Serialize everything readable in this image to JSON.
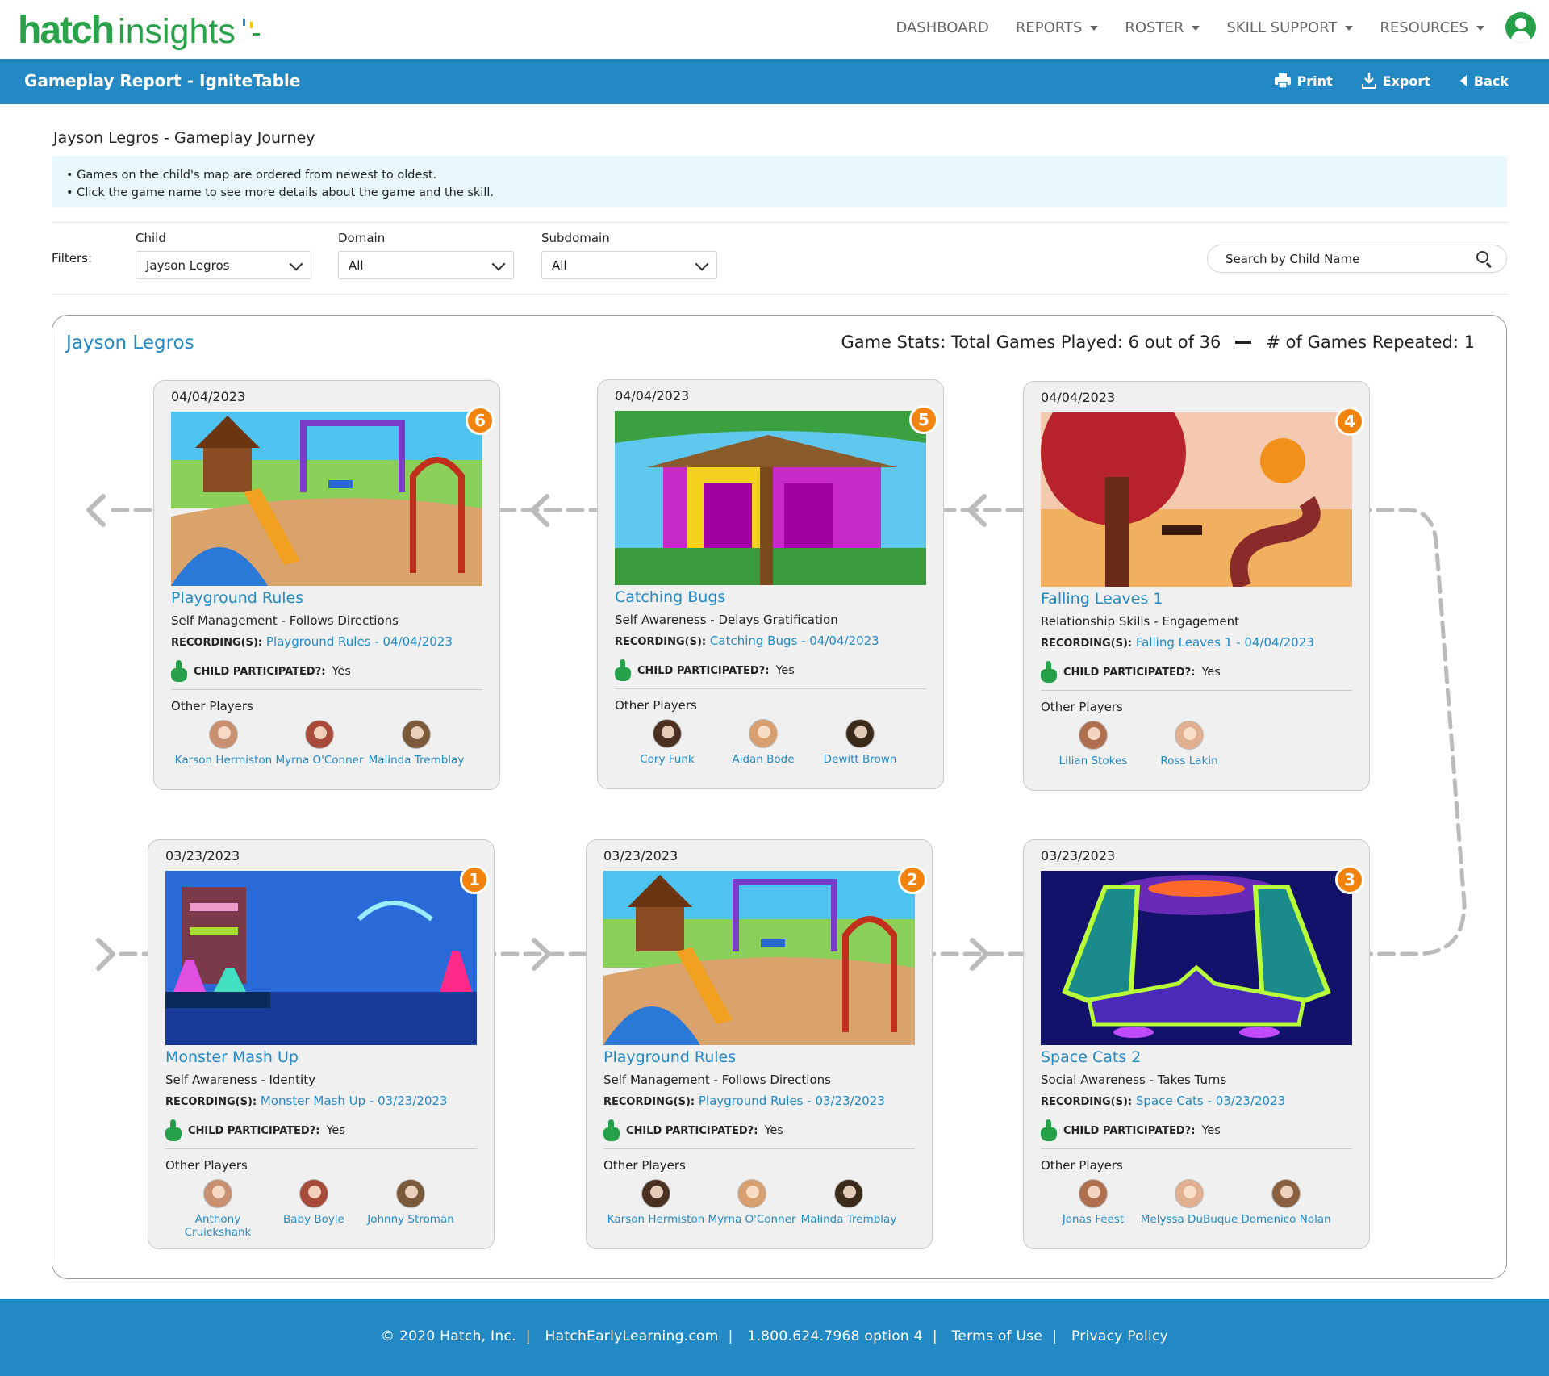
{
  "brand": {
    "hatch": "hatch",
    "insights": "insights"
  },
  "nav": [
    {
      "label": "DASHBOARD",
      "dropdown": false
    },
    {
      "label": "REPORTS",
      "dropdown": true
    },
    {
      "label": "ROSTER",
      "dropdown": true
    },
    {
      "label": "SKILL SUPPORT",
      "dropdown": true
    },
    {
      "label": "RESOURCES",
      "dropdown": true
    }
  ],
  "report": {
    "title": "Gameplay Report - IgniteTable",
    "print": "Print",
    "export": "Export",
    "back": "Back"
  },
  "journey_title": "Jayson Legros - Gameplay Journey",
  "info": [
    "Games on the child's map are ordered from newest to oldest.",
    "Click the game name to see more details about the game and the skill."
  ],
  "filters": {
    "label": "Filters:",
    "child": {
      "label": "Child",
      "value": "Jayson Legros"
    },
    "domain": {
      "label": "Domain",
      "value": "All"
    },
    "subdomain": {
      "label": "Subdomain",
      "value": "All"
    },
    "search_placeholder": "Search by Child Name"
  },
  "panel": {
    "child_name": "Jayson Legros",
    "stats_played": "Game Stats: Total Games Played: 6 out of 36",
    "stats_repeated": "# of Games Repeated: 1"
  },
  "labels": {
    "recordings": "RECORDING(S):",
    "participated": "CHILD PARTICIPATED?:",
    "other_players": "Other Players"
  },
  "colors": {
    "accent": "#2389c5",
    "green": "#27a04a",
    "badge": "#f2830c"
  },
  "cards": [
    {
      "date": "04/04/2023",
      "number": "6",
      "name": "Playground Rules",
      "skill": "Self Management - Follows Directions",
      "recording": "Playground Rules - 04/04/2023",
      "participated": "Yes",
      "players": [
        "Karson Hermiston",
        "Myrna O'Conner",
        "Malinda Tremblay"
      ],
      "scene": "playground"
    },
    {
      "date": "04/04/2023",
      "number": "5",
      "name": "Catching Bugs",
      "skill": "Self Awareness - Delays Gratification",
      "recording": "Catching Bugs - 04/04/2023",
      "participated": "Yes",
      "players": [
        "Cory Funk",
        "Aidan Bode",
        "Dewitt Brown"
      ],
      "scene": "treehouse"
    },
    {
      "date": "04/04/2023",
      "number": "4",
      "name": "Falling Leaves 1",
      "skill": "Relationship Skills - Engagement",
      "recording": "Falling Leaves 1 - 04/04/2023",
      "participated": "Yes",
      "players": [
        "Lilian Stokes",
        "Ross Lakin"
      ],
      "scene": "autumn"
    },
    {
      "date": "03/23/2023",
      "number": "1",
      "name": "Monster Mash Up",
      "skill": "Self Awareness - Identity",
      "recording": "Monster Mash Up - 03/23/2023",
      "participated": "Yes",
      "players": [
        "Anthony Cruickshank",
        "Baby Boyle",
        "Johnny Stroman"
      ],
      "scene": "lab"
    },
    {
      "date": "03/23/2023",
      "number": "2",
      "name": "Playground Rules",
      "skill": "Self Management - Follows Directions",
      "recording": "Playground Rules - 03/23/2023",
      "participated": "Yes",
      "players": [
        "Karson Hermiston",
        "Myrna O'Conner",
        "Malinda Tremblay"
      ],
      "scene": "playground"
    },
    {
      "date": "03/23/2023",
      "number": "3",
      "name": "Space Cats 2",
      "skill": "Social Awareness - Takes Turns",
      "recording": "Space Cats - 03/23/2023",
      "participated": "Yes",
      "players": [
        "Jonas Feest",
        "Melyssa DuBuque",
        "Domenico Nolan"
      ],
      "scene": "space"
    }
  ],
  "footer": [
    "© 2020 Hatch, Inc.",
    "HatchEarlyLearning.com",
    "1.800.624.7968 option 4",
    "Terms of Use",
    "Privacy Policy"
  ]
}
